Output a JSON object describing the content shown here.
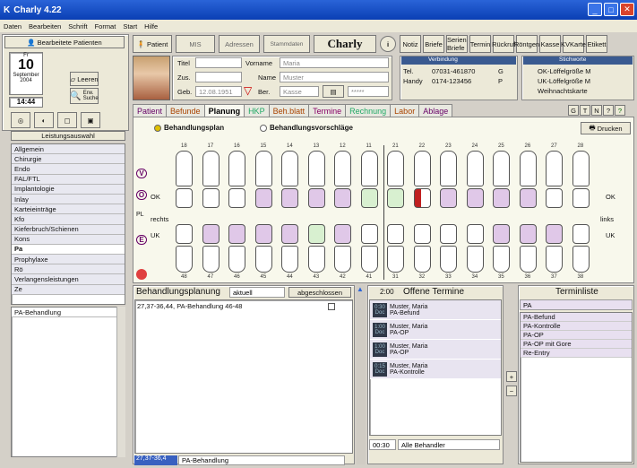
{
  "window": {
    "title": "Charly 4.22"
  },
  "menu": [
    "Daten",
    "Bearbeiten",
    "Schrift",
    "Format",
    "Start",
    "Hilfe"
  ],
  "leftpanel": {
    "bearbeitete_label": "Bearbeitete Patienten",
    "date": {
      "weekday": "Fr",
      "day": "10",
      "month": "September",
      "year": "2004"
    },
    "time": "14:44",
    "leeren_label": "Leeren",
    "erw_suche_label": "Erw. Suche",
    "leistungsauswahl_label": "Leistungsauswahl",
    "categories": [
      "Allgemein",
      "Chirurgie",
      "Endo",
      "FAL/FTL",
      "Implantologie",
      "Inlay",
      "Karteieinträge",
      "Kfo",
      "Kieferbruch/Schienen",
      "Kons",
      "Pa",
      "Prophylaxe",
      "Rö",
      "Verlangensleistungen",
      "Ze"
    ],
    "selected_category": "Pa",
    "sub_items": [
      "PA-Behandlung"
    ]
  },
  "toolbar": {
    "patient": "Patient",
    "mis": "MIS",
    "adressen": "Adressen",
    "stammdaten": "Stammdaten",
    "logo": "Charly",
    "icons": [
      "Notiz",
      "Briefe",
      "Serien Briefe",
      "Termin",
      "Rückruf",
      "Röntgen",
      "Kasse",
      "KVKarte",
      "Etikett"
    ]
  },
  "patient": {
    "titel_label": "Titel",
    "vorname_label": "Vorname",
    "vorname": "Maria",
    "zus_label": "Zus.",
    "name_label": "Name",
    "name": "Muster",
    "geb_label": "Geb.",
    "geb": "12.08.1951",
    "ber_label": "Ber.",
    "kasse": "Kasse",
    "stars": "*****"
  },
  "contact": {
    "header": "Verbindung",
    "tel_label": "Tel.",
    "tel": "07031-461870",
    "tel_code": "G",
    "handy_label": "Handy",
    "handy": "0174-123456",
    "handy_code": "P"
  },
  "stichworte": {
    "header": "Stichworte",
    "items": [
      "OK-Löffelgröße M",
      "UK-Löffelgröße M",
      "Weihnachtskarte"
    ]
  },
  "tabs": [
    "Patient",
    "Befunde",
    "Planung",
    "HKP",
    "Beh.blatt",
    "Termine",
    "Rechnung",
    "Labor",
    "Ablage"
  ],
  "active_tab": "Planung",
  "tab_buttons": [
    "G",
    "T",
    "N",
    "?",
    "?"
  ],
  "planung": {
    "option1": "Behandlungsplan",
    "option2": "Behandlungsvorschläge",
    "drucken": "Drucken",
    "ok_label": "OK",
    "uk_label": "UK",
    "rechts": "rechts",
    "links": "links",
    "upper_numbers": [
      "18",
      "17",
      "16",
      "15",
      "14",
      "13",
      "12",
      "11",
      "21",
      "22",
      "23",
      "24",
      "25",
      "26",
      "27",
      "28"
    ],
    "lower_numbers": [
      "48",
      "47",
      "46",
      "45",
      "44",
      "43",
      "42",
      "41",
      "31",
      "32",
      "33",
      "34",
      "35",
      "36",
      "37",
      "38"
    ],
    "side_letters": [
      "V",
      "O",
      "PL",
      "E"
    ]
  },
  "behandlungsplanung": {
    "title": "Behandlungsplanung",
    "filter": "aktuell",
    "abgeschlossen": "abgeschlossen",
    "entry": "27,37-36,44, PA-Behandlung 46-48",
    "bottom_code": "27,37-36,4",
    "bottom_text": "PA-Behandlung"
  },
  "offene_termine": {
    "time": "2:00",
    "title": "Offene Termine",
    "items": [
      {
        "name": "Muster, Maria",
        "what": "PA-Befund",
        "t": "0:30",
        "d": "Doc"
      },
      {
        "name": "Muster, Maria",
        "what": "PA-OP",
        "t": "1:00",
        "d": "Doc"
      },
      {
        "name": "Muster, Maria",
        "what": "PA-OP",
        "t": "1:00",
        "d": "Doc"
      },
      {
        "name": "Muster, Maria",
        "what": "PA-Kontrolle",
        "t": "0:15",
        "d": "Doc"
      }
    ],
    "bottom_time": "00:30",
    "behandler": "Alle Behandler"
  },
  "terminliste": {
    "title": "Terminliste",
    "selected": "PA",
    "items": [
      "PA-Befund",
      "PA-Kontrolle",
      "PA-OP",
      "PA-OP mit Gore",
      "Re-Entry"
    ]
  }
}
